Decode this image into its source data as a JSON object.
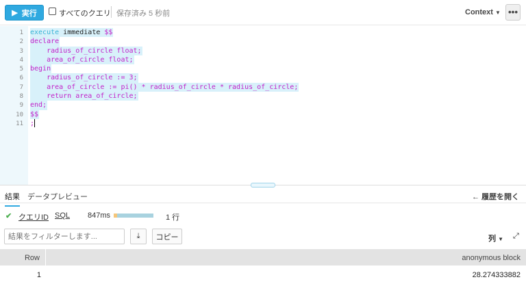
{
  "toolbar": {
    "run_label": "実行",
    "all_queries_label": "すべてのクエリ",
    "saved_status": "保存済み 5 秒前",
    "context_label": "Context",
    "more_label": "•••"
  },
  "editor": {
    "lines": [
      {
        "n": "1",
        "tokens": [
          {
            "t": "execute",
            "c": "kw"
          },
          {
            "t": " immediate ",
            "c": "id"
          },
          {
            "t": "$$",
            "c": "m"
          }
        ]
      },
      {
        "n": "2",
        "tokens": [
          {
            "t": "declare",
            "c": "m"
          }
        ]
      },
      {
        "n": "3",
        "tokens": [
          {
            "t": "    radius_of_circle float;",
            "c": "m"
          }
        ]
      },
      {
        "n": "4",
        "tokens": [
          {
            "t": "    area_of_circle float;",
            "c": "m"
          }
        ]
      },
      {
        "n": "5",
        "tokens": [
          {
            "t": "begin",
            "c": "m"
          }
        ]
      },
      {
        "n": "6",
        "tokens": [
          {
            "t": "    radius_of_circle := 3;",
            "c": "m"
          }
        ]
      },
      {
        "n": "7",
        "tokens": [
          {
            "t": "    area_of_circle := pi() * radius_of_circle * radius_of_circle;",
            "c": "m"
          }
        ]
      },
      {
        "n": "8",
        "tokens": [
          {
            "t": "    return area_of_circle;",
            "c": "m"
          }
        ]
      },
      {
        "n": "9",
        "tokens": [
          {
            "t": "end;",
            "c": "m"
          }
        ]
      },
      {
        "n": "10",
        "tokens": [
          {
            "t": "$$",
            "c": "m"
          }
        ]
      },
      {
        "n": "11",
        "tokens": [
          {
            "t": ";",
            "c": "m"
          }
        ]
      }
    ]
  },
  "results": {
    "tabs": [
      "結果",
      "データプレビュー"
    ],
    "history_label": "履歴を開く",
    "query_id_label": "クエリID",
    "sql_label": "SQL",
    "duration": "847ms",
    "duration_fraction_queued": 0.08,
    "row_count": "1 行",
    "filter_placeholder": "結果をフィルターします...",
    "copy_label": "コピー",
    "columns_label": "列",
    "table": {
      "headers": [
        "Row",
        "anonymous block"
      ],
      "rows": [
        [
          "1",
          "28.274333882"
        ]
      ]
    }
  },
  "colors": {
    "accent": "#2fa9e0",
    "success": "#4caf50",
    "keyword": "#3ab4d6",
    "string": "#c21fc9"
  }
}
